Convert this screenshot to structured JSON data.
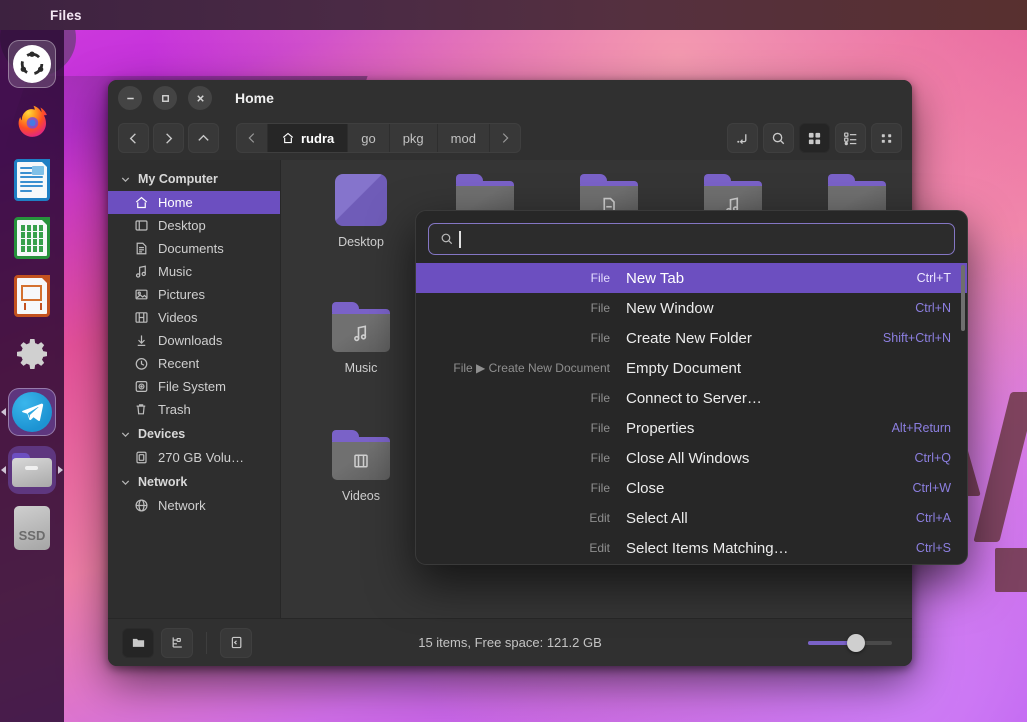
{
  "panel": {
    "app_name": "Files"
  },
  "dock": {
    "items": [
      {
        "name": "ubuntu-show-applications",
        "label": "Show Applications",
        "icon": "ubuntu-icon",
        "state": "focused"
      },
      {
        "name": "firefox",
        "label": "Firefox",
        "icon": "firefox-icon",
        "state": "idle"
      },
      {
        "name": "libreoffice-writer",
        "label": "LibreOffice Writer",
        "icon": "document-icon",
        "state": "idle"
      },
      {
        "name": "libreoffice-calc",
        "label": "LibreOffice Calc",
        "icon": "spreadsheet-icon",
        "state": "idle"
      },
      {
        "name": "libreoffice-impress",
        "label": "LibreOffice Impress",
        "icon": "presentation-icon",
        "state": "idle"
      },
      {
        "name": "settings",
        "label": "Settings",
        "icon": "gear-icon",
        "state": "idle"
      },
      {
        "name": "telegram",
        "label": "Telegram",
        "icon": "telegram-icon",
        "state": "running"
      },
      {
        "name": "files",
        "label": "Files",
        "icon": "files-folder-icon",
        "state": "active"
      },
      {
        "name": "ssd-drive",
        "label": "SSD",
        "icon": "ssd-icon",
        "state": "idle"
      }
    ],
    "ssd_label": "SSD"
  },
  "window": {
    "title": "Home",
    "controls": {
      "minimize": "minimize-icon",
      "maximize": "maximize-icon",
      "close": "close-icon"
    }
  },
  "toolbar": {
    "nav": [
      {
        "name": "back-button",
        "icon": "chevron-left-icon"
      },
      {
        "name": "forward-button",
        "icon": "chevron-right-icon"
      },
      {
        "name": "up-button",
        "icon": "chevron-up-icon"
      }
    ],
    "pathbar": {
      "overflow_icon": "chevron-left-icon",
      "segments": [
        {
          "label": "rudra",
          "icon": "home-icon",
          "current": true
        },
        {
          "label": "go",
          "current": false
        },
        {
          "label": "pkg",
          "current": false
        },
        {
          "label": "mod",
          "current": false
        }
      ],
      "next_icon": "chevron-right-icon"
    },
    "right_buttons": [
      {
        "name": "path-entry-button",
        "icon": "path-entry-icon",
        "active": false
      },
      {
        "name": "search-button",
        "icon": "search-icon",
        "active": false
      },
      {
        "name": "grid-view-button",
        "icon": "grid-view-icon",
        "active": true
      },
      {
        "name": "list-view-button",
        "icon": "list-view-icon",
        "active": false
      },
      {
        "name": "view-options-button",
        "icon": "view-options-icon",
        "active": false
      }
    ]
  },
  "sidebar": {
    "groups": [
      {
        "title": "My Computer",
        "items": [
          {
            "label": "Home",
            "icon": "home-icon",
            "selected": true,
            "underline": false
          },
          {
            "label": "Desktop",
            "icon": "desktop-icon",
            "selected": false,
            "underline": false
          },
          {
            "label": "Documents",
            "icon": "document-icon",
            "selected": false,
            "underline": false
          },
          {
            "label": "Music",
            "icon": "music-note-icon",
            "selected": false,
            "underline": false
          },
          {
            "label": "Pictures",
            "icon": "image-icon",
            "selected": false,
            "underline": false
          },
          {
            "label": "Videos",
            "icon": "film-icon",
            "selected": false,
            "underline": false
          },
          {
            "label": "Downloads",
            "icon": "download-arrow-icon",
            "selected": false,
            "underline": false
          },
          {
            "label": "Recent",
            "icon": "clock-icon",
            "selected": false,
            "underline": false
          },
          {
            "label": "File System",
            "icon": "disk-icon",
            "selected": false,
            "underline": true
          },
          {
            "label": "Trash",
            "icon": "trash-icon",
            "selected": false,
            "underline": false
          }
        ]
      },
      {
        "title": "Devices",
        "items": [
          {
            "label": "270 GB Volu…",
            "icon": "drive-icon",
            "selected": false,
            "underline": false
          }
        ]
      },
      {
        "title": "Network",
        "items": [
          {
            "label": "Network",
            "icon": "globe-icon",
            "selected": false,
            "underline": false
          }
        ]
      }
    ]
  },
  "content": {
    "files": [
      {
        "label": "Desktop",
        "icon": "desktop-folder-icon",
        "glyph": ""
      },
      {
        "label": "",
        "icon": "folder-icon",
        "glyph": ""
      },
      {
        "label": "",
        "icon": "folder-icon",
        "glyph": "document-glyph"
      },
      {
        "label": "",
        "icon": "folder-icon",
        "glyph": "music-glyph"
      },
      {
        "label": "",
        "icon": "folder-icon",
        "glyph": ""
      },
      {
        "label": "Music",
        "icon": "folder-icon",
        "glyph": "music-glyph"
      },
      {
        "label": "Videos",
        "icon": "folder-icon",
        "glyph": "film-glyph"
      }
    ]
  },
  "statusbar": {
    "buttons": [
      {
        "name": "places-toggle-button",
        "icon": "folder-icon",
        "active": true
      },
      {
        "name": "tree-toggle-button",
        "icon": "tree-icon",
        "active": false
      },
      {
        "name": "sidebar-toggle-button",
        "icon": "sidebar-toggle-icon",
        "active": false
      }
    ],
    "status_text": "15 items, Free space: 121.2 GB",
    "zoom": {
      "value": 60,
      "min": 0,
      "max": 100
    }
  },
  "palette": {
    "search": {
      "value": "",
      "placeholder": "",
      "icon": "search-icon"
    },
    "items": [
      {
        "context": "File",
        "label": "New Tab",
        "accel": "Ctrl+T",
        "selected": true
      },
      {
        "context": "File",
        "label": "New Window",
        "accel": "Ctrl+N",
        "selected": false
      },
      {
        "context": "File",
        "label": "Create New Folder",
        "accel": "Shift+Ctrl+N",
        "selected": false
      },
      {
        "context": "File ▶ Create New Document",
        "label": "Empty Document",
        "accel": "",
        "selected": false
      },
      {
        "context": "File",
        "label": "Connect to Server…",
        "accel": "",
        "selected": false
      },
      {
        "context": "File",
        "label": "Properties",
        "accel": "Alt+Return",
        "selected": false
      },
      {
        "context": "File",
        "label": "Close All Windows",
        "accel": "Ctrl+Q",
        "selected": false
      },
      {
        "context": "File",
        "label": "Close",
        "accel": "Ctrl+W",
        "selected": false
      },
      {
        "context": "Edit",
        "label": "Select All",
        "accel": "Ctrl+A",
        "selected": false
      },
      {
        "context": "Edit",
        "label": "Select Items Matching…",
        "accel": "Ctrl+S",
        "selected": false
      }
    ]
  },
  "colors": {
    "accent": "#6c4fc0",
    "accel_text": "#8c7fe0",
    "window_bg": "#303030",
    "sidebar_bg": "#2e2e2e",
    "content_bg": "#353535",
    "palette_bg": "#272727"
  }
}
